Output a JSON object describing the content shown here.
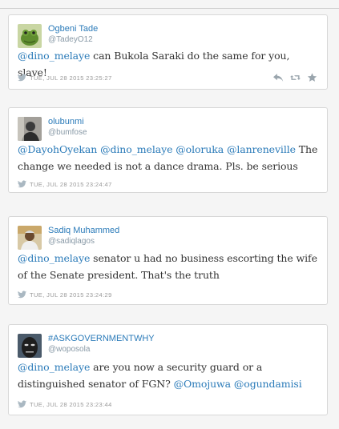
{
  "tweets": [
    {
      "name": "Ogbeni Tade",
      "handle": "@TadeyO12",
      "segments": [
        {
          "text": "@dino_melaye",
          "mention": true
        },
        {
          "text": " can Bukola Saraki do the same for you, slave!",
          "mention": false
        }
      ],
      "timestamp": "TUE, JUL 28 2015 23:25:27",
      "avatar_icon": "frog-avatar-icon",
      "show_actions": true
    },
    {
      "name": "olubunmi",
      "handle": "@bumfose",
      "segments": [
        {
          "text": "@DayohOyekan",
          "mention": true
        },
        {
          "text": " ",
          "mention": false
        },
        {
          "text": "@dino_melaye",
          "mention": true
        },
        {
          "text": " ",
          "mention": false
        },
        {
          "text": "@oloruka",
          "mention": true
        },
        {
          "text": " ",
          "mention": false
        },
        {
          "text": "@lanreneville",
          "mention": true
        },
        {
          "text": " The change we needed is not a dance drama. Pls. be serious",
          "mention": false
        }
      ],
      "timestamp": "TUE, JUL 28 2015 23:24:47",
      "avatar_icon": "portrait-avatar-icon",
      "show_actions": false
    },
    {
      "name": "Sadiq Muhammed",
      "handle": "@sadiqlagos",
      "segments": [
        {
          "text": "@dino_melaye",
          "mention": true
        },
        {
          "text": " senator u had no business escorting the wife of the Senate president. That's the truth",
          "mention": false
        }
      ],
      "timestamp": "TUE, JUL 28 2015 23:24:29",
      "avatar_icon": "person-avatar-icon",
      "show_actions": false
    },
    {
      "name": "#ASKGOVERNMENTWHY",
      "handle": "@woposola",
      "segments": [
        {
          "text": "@dino_melaye",
          "mention": true
        },
        {
          "text": " are you now a security guard or a distinguished senator of FGN? ",
          "mention": false
        },
        {
          "text": "@Omojuwa",
          "mention": true
        },
        {
          "text": " ",
          "mention": false
        },
        {
          "text": "@ogundamisi",
          "mention": true
        }
      ],
      "timestamp": "TUE, JUL 28 2015 23:23:44",
      "avatar_icon": "face-avatar-icon",
      "show_actions": false
    }
  ],
  "icons": {
    "bird": "twitter-bird-icon",
    "reply": "reply-icon",
    "retweet": "retweet-icon",
    "favorite": "star-icon"
  },
  "colors": {
    "link": "#2b7bb9",
    "text": "#333333",
    "muted": "#999999",
    "background": "#f5f5f5",
    "card": "#ffffff"
  }
}
